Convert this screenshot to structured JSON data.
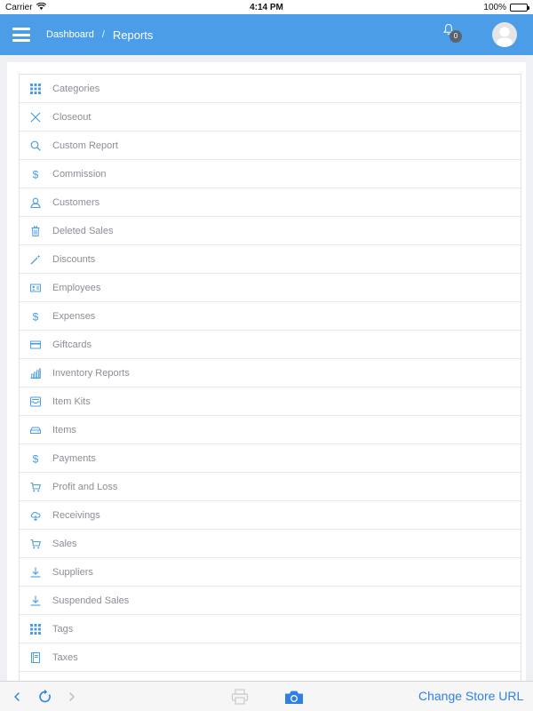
{
  "status_bar": {
    "carrier": "Carrier",
    "time": "4:14 PM",
    "battery": "100%"
  },
  "header": {
    "breadcrumb_parent": "Dashboard",
    "breadcrumb_separator": "/",
    "title": "Reports",
    "notification_count": "0",
    "accent_color": "#4a9de6"
  },
  "reports": [
    {
      "label": "Categories",
      "icon": "grid-icon"
    },
    {
      "label": "Closeout",
      "icon": "close-icon"
    },
    {
      "label": "Custom Report",
      "icon": "search-icon"
    },
    {
      "label": "Commission",
      "icon": "dollar-icon"
    },
    {
      "label": "Customers",
      "icon": "user-icon"
    },
    {
      "label": "Deleted Sales",
      "icon": "trash-icon"
    },
    {
      "label": "Discounts",
      "icon": "magic-wand-icon"
    },
    {
      "label": "Employees",
      "icon": "id-card-icon"
    },
    {
      "label": "Expenses",
      "icon": "dollar-icon"
    },
    {
      "label": "Giftcards",
      "icon": "credit-card-icon"
    },
    {
      "label": "Inventory Reports",
      "icon": "bar-chart-icon"
    },
    {
      "label": "Item Kits",
      "icon": "inbox-icon"
    },
    {
      "label": "Items",
      "icon": "box-icon"
    },
    {
      "label": "Payments",
      "icon": "dollar-icon"
    },
    {
      "label": "Profit and Loss",
      "icon": "cart-icon"
    },
    {
      "label": "Receivings",
      "icon": "cloud-download-icon"
    },
    {
      "label": "Sales",
      "icon": "cart-icon"
    },
    {
      "label": "Suppliers",
      "icon": "download-icon"
    },
    {
      "label": "Suspended Sales",
      "icon": "download-icon"
    },
    {
      "label": "Tags",
      "icon": "grid-icon"
    },
    {
      "label": "Taxes",
      "icon": "book-icon"
    },
    {
      "label": "",
      "icon": ""
    }
  ],
  "bottom_bar": {
    "change_store_url": "Change Store URL"
  }
}
